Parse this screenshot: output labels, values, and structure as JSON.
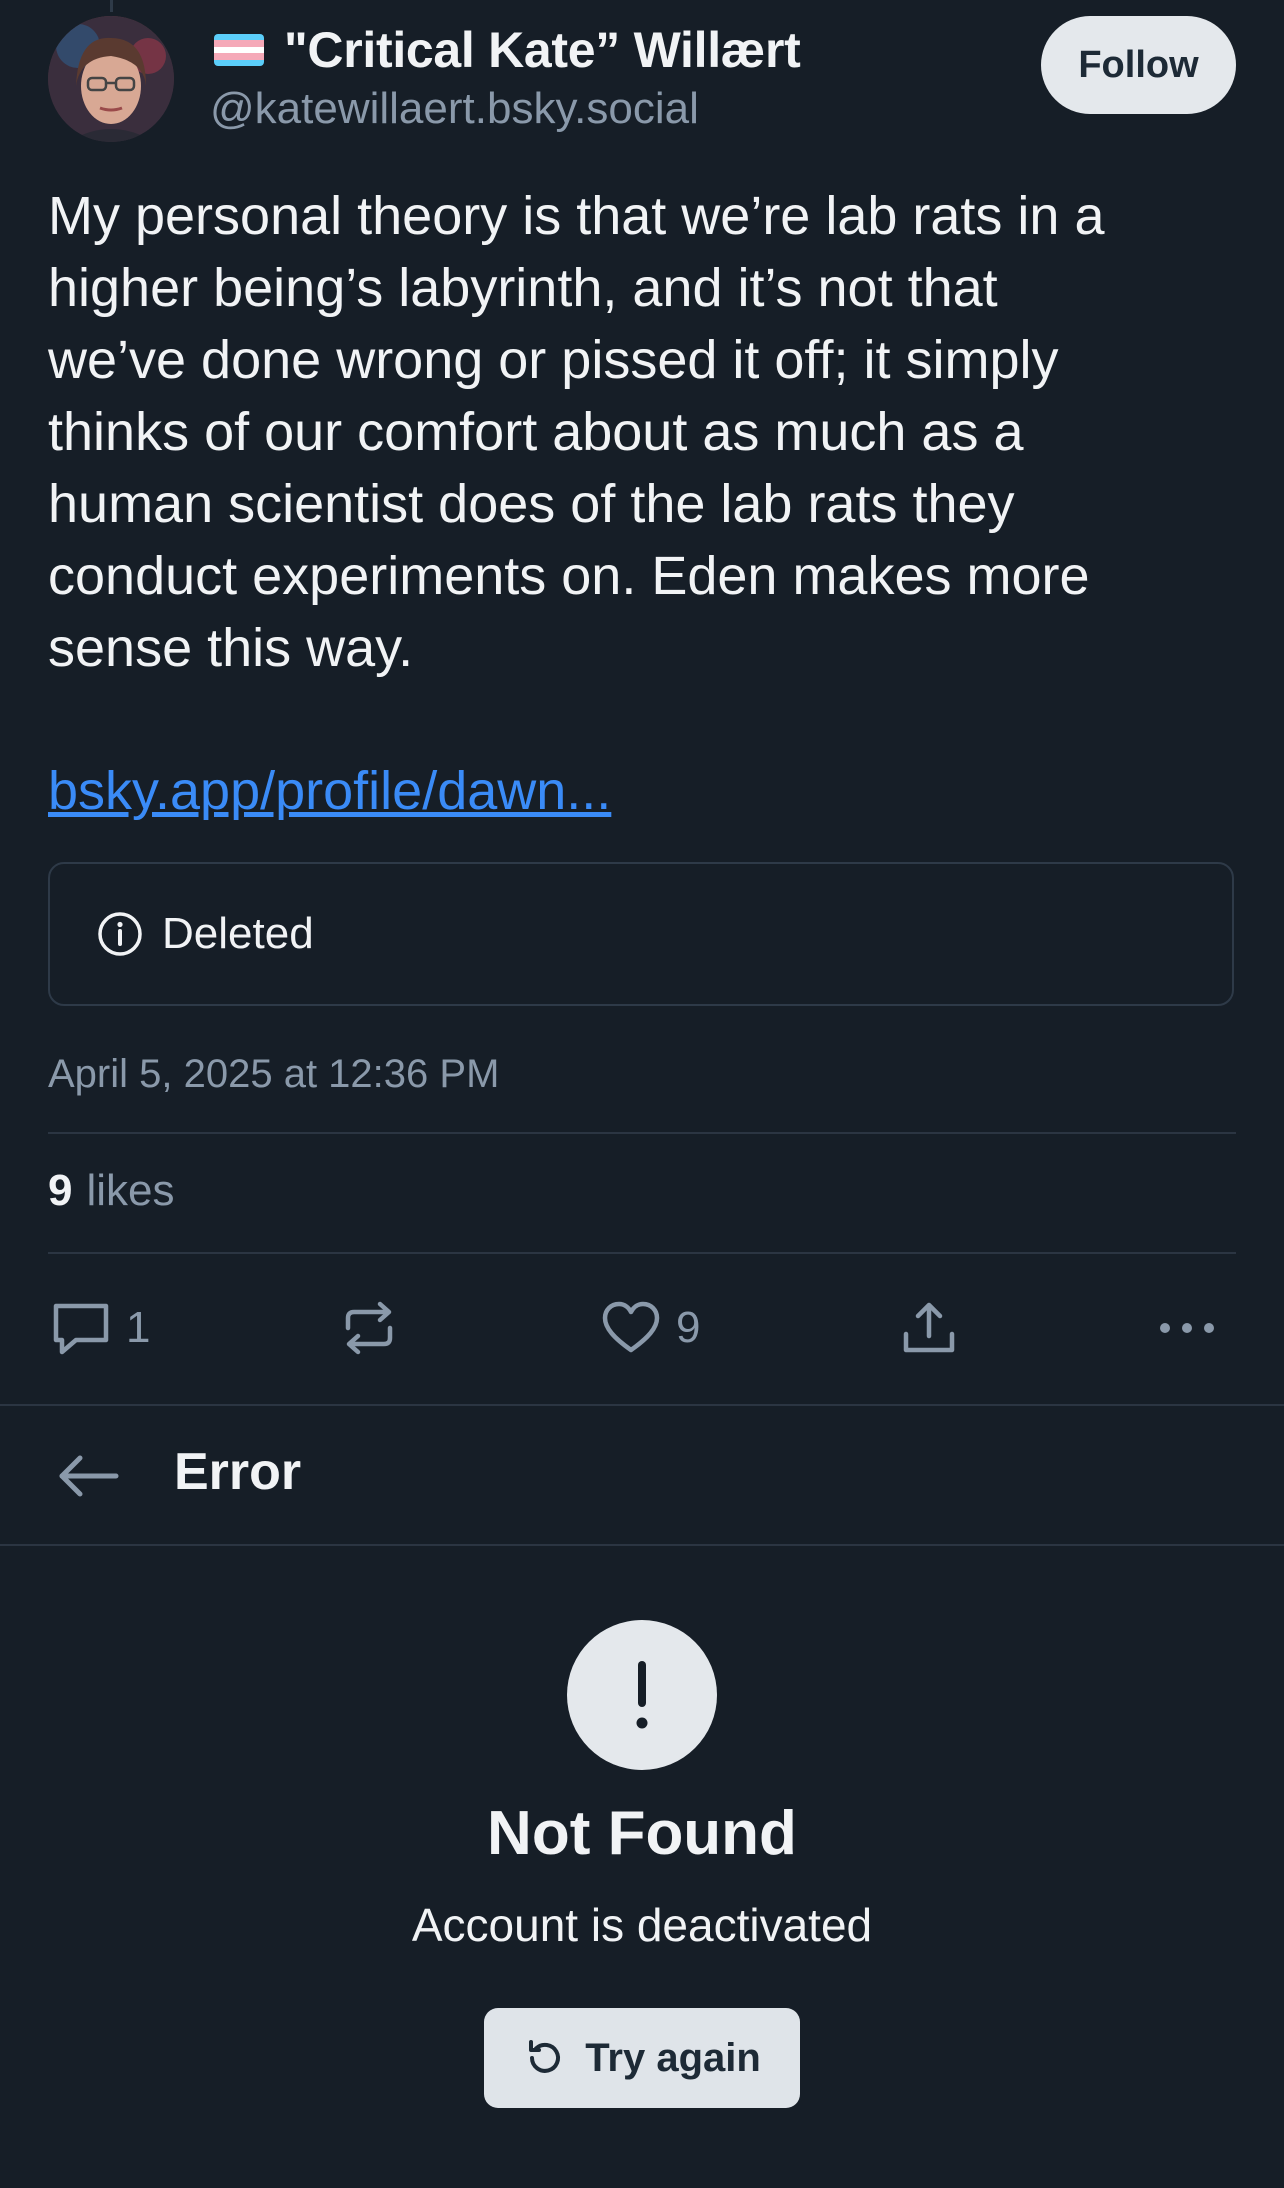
{
  "post": {
    "author": {
      "display_name": "\"Critical Kate” Willært",
      "handle": "@katewillaert.bsky.social",
      "flag_icon": "transgender-flag-emoji"
    },
    "follow_label": "Follow",
    "text": "My personal theory is that we’re lab rats in a\nhigher being’s labyrinth, and it’s not that\nwe’ve done wrong or pissed it off; it simply\nthinks of our comfort about as much as a\nhuman scientist does of the lab rats they\nconduct experiments on. Eden makes more\nsense this way.",
    "link": "bsky.app/profile/dawn...",
    "embed": {
      "icon": "info-icon",
      "label": "Deleted"
    },
    "timestamp": "April 5, 2025 at 12:36 PM",
    "likes": {
      "count": "9",
      "label": "likes"
    },
    "actions": {
      "reply_count": "1",
      "like_count": "9"
    }
  },
  "error_screen": {
    "title": "Error",
    "heading": "Not Found",
    "message": "Account is deactivated",
    "retry_label": "Try again"
  },
  "colors": {
    "background": "#161e27",
    "text": "#f1f3f5",
    "muted": "#8a99aa",
    "link": "#3a8bf7",
    "divider": "#2b3542",
    "button_bg": "#e4e8ec"
  }
}
